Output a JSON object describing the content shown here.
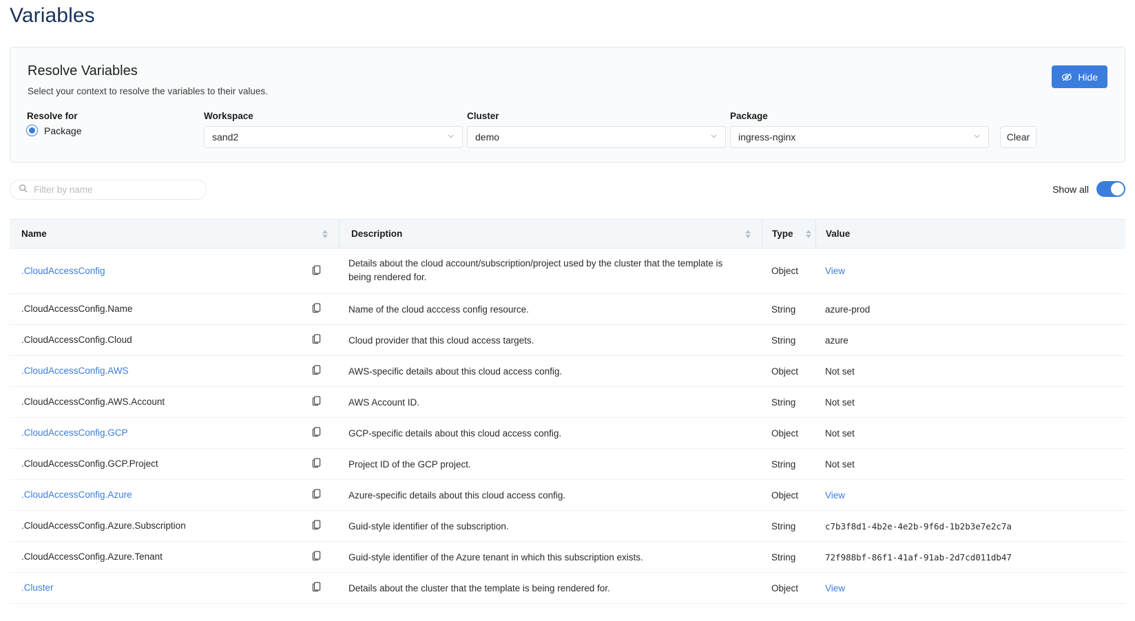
{
  "page": {
    "title": "Variables"
  },
  "resolve_panel": {
    "title": "Resolve Variables",
    "subtitle": "Select your context to resolve the variables to their values.",
    "hide_button": "Hide",
    "hide_icon": "eye-slash-icon",
    "resolve_for_label": "Resolve for",
    "resolve_for_option": "Package",
    "workspace_label": "Workspace",
    "workspace_value": "sand2",
    "cluster_label": "Cluster",
    "cluster_value": "demo",
    "package_label": "Package",
    "package_value": "ingress-nginx",
    "clear_button": "Clear",
    "accent_color": "#3b7ddd"
  },
  "toolbar": {
    "filter_placeholder": "Filter by name",
    "filter_value": "",
    "search_icon": "search-icon",
    "show_all_label": "Show all",
    "show_all_on": true
  },
  "table": {
    "columns": [
      {
        "label": "Name",
        "sortable": true
      },
      {
        "label": "Description",
        "sortable": true
      },
      {
        "label": "Type",
        "sortable": true
      },
      {
        "label": "Value",
        "sortable": false
      }
    ],
    "rows": [
      {
        "name": ".CloudAccessConfig",
        "name_is_link": true,
        "description": "Details about the cloud account/subscription/project used by the cluster that the template is being rendered for.",
        "type": "Object",
        "value": "View",
        "value_is_link": true,
        "tall": true
      },
      {
        "name": ".CloudAccessConfig.Name",
        "name_is_link": false,
        "description": "Name of the cloud acccess config resource.",
        "type": "String",
        "value": "azure-prod",
        "value_is_link": false,
        "tall": false
      },
      {
        "name": ".CloudAccessConfig.Cloud",
        "name_is_link": false,
        "description": "Cloud provider that this cloud access targets.",
        "type": "String",
        "value": "azure",
        "value_is_link": false,
        "tall": false
      },
      {
        "name": ".CloudAccessConfig.AWS",
        "name_is_link": true,
        "description": "AWS-specific details about this cloud access config.",
        "type": "Object",
        "value": "Not set",
        "value_is_link": false,
        "tall": false
      },
      {
        "name": ".CloudAccessConfig.AWS.Account",
        "name_is_link": false,
        "description": "AWS Account ID.",
        "type": "String",
        "value": "Not set",
        "value_is_link": false,
        "tall": false
      },
      {
        "name": ".CloudAccessConfig.GCP",
        "name_is_link": true,
        "description": "GCP-specific details about this cloud access config.",
        "type": "Object",
        "value": "Not set",
        "value_is_link": false,
        "tall": false
      },
      {
        "name": ".CloudAccessConfig.GCP.Project",
        "name_is_link": false,
        "description": "Project ID of the GCP project.",
        "type": "String",
        "value": "Not set",
        "value_is_link": false,
        "tall": false
      },
      {
        "name": ".CloudAccessConfig.Azure",
        "name_is_link": true,
        "description": "Azure-specific details about this cloud access config.",
        "type": "Object",
        "value": "View",
        "value_is_link": true,
        "tall": false
      },
      {
        "name": ".CloudAccessConfig.Azure.Subscription",
        "name_is_link": false,
        "description": "Guid-style identifier of the subscription.",
        "type": "String",
        "value": "c7b3f8d1-4b2e-4e2b-9f6d-1b2b3e7e2c7a",
        "value_is_link": false,
        "value_mono": true,
        "tall": false
      },
      {
        "name": ".CloudAccessConfig.Azure.Tenant",
        "name_is_link": false,
        "description": "Guid-style identifier of the Azure tenant in which this subscription exists.",
        "type": "String",
        "value": "72f988bf-86f1-41af-91ab-2d7cd011db47",
        "value_is_link": false,
        "value_mono": true,
        "tall": false
      },
      {
        "name": ".Cluster",
        "name_is_link": true,
        "description": "Details about the cluster that the template is being rendered for.",
        "type": "Object",
        "value": "View",
        "value_is_link": true,
        "tall": false
      }
    ],
    "copy_icon": "copy-icon"
  }
}
